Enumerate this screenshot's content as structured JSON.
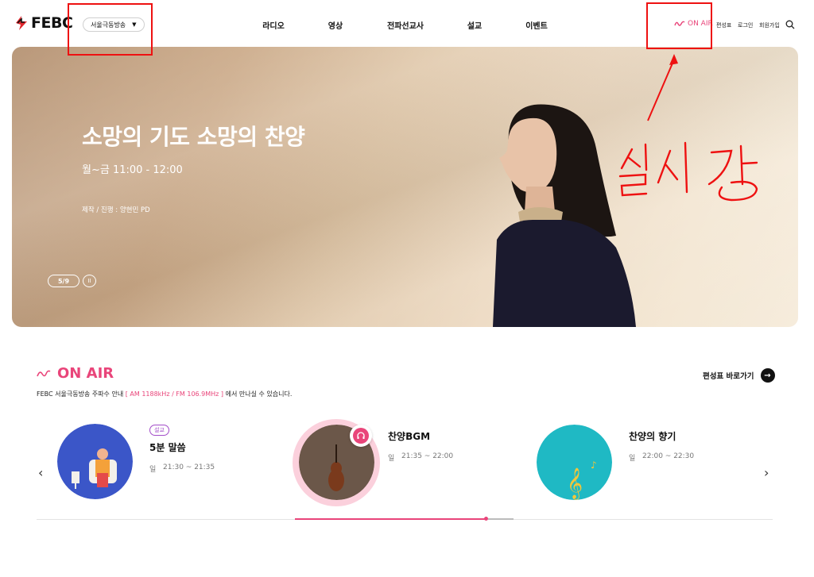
{
  "header": {
    "logo_text": "FEBC",
    "station_selector": "서울극동방송",
    "nav": [
      "라디오",
      "영상",
      "전파선교사",
      "설교",
      "이벤트"
    ],
    "onair_label": "ON AIR",
    "util_links": [
      "편성표",
      "로그인",
      "회원가입"
    ]
  },
  "hero": {
    "title": "소망의 기도 소망의 찬양",
    "time": "월~금 11:00 - 12:00",
    "credit": "제작 / 진행 : 양현민 PD",
    "counter": "5/9",
    "pause_symbol": "II"
  },
  "annotation": {
    "text": "실시간",
    "color": "#e11111"
  },
  "onair": {
    "title": "ON AIR",
    "subtitle_prefix": "FEBC 서울극동방송 주파수 안내",
    "subtitle_freq": "[ AM 1188kHz / FM 106.9MHz ]",
    "subtitle_suffix": "에서 만나실 수 있습니다.",
    "schedule_link": "편성표 바로가기",
    "programs": [
      {
        "badge": "설교",
        "name": "5분 말씀",
        "day": "일",
        "time": "21:30 ~ 21:35"
      },
      {
        "badge": "",
        "name": "찬양BGM",
        "day": "일",
        "time": "21:35 ~ 22:00"
      },
      {
        "badge": "",
        "name": "찬양의 향기",
        "day": "일",
        "time": "22:00 ~ 22:30"
      }
    ],
    "progress": 0.63
  },
  "colors": {
    "accent": "#e9457a",
    "badge": "#a24cc9"
  }
}
